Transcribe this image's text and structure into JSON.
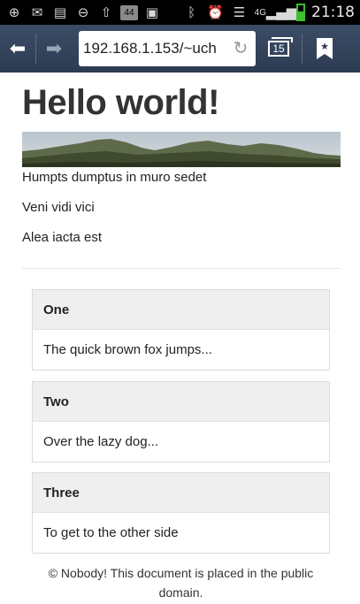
{
  "statusbar": {
    "left_icons": [
      "add-icon",
      "mail-icon",
      "clipboard-icon",
      "minus-circle-icon",
      "upload-icon"
    ],
    "badge": "44",
    "right_icons": [
      "image-icon",
      "bluetooth-icon",
      "alarm-icon",
      "wifi-icon",
      "signal-icon"
    ],
    "network": "4G",
    "time": "21:18"
  },
  "browser": {
    "url": "192.168.1.153/~uch",
    "tab_count": "15"
  },
  "page": {
    "title": "Hello world!",
    "lines": [
      "Humpts dumptus in muro sedet",
      "Veni vidi vici",
      "Alea iacta est"
    ],
    "panels": [
      {
        "heading": "One",
        "body": "The quick brown fox jumps..."
      },
      {
        "heading": "Two",
        "body": "Over the lazy dog..."
      },
      {
        "heading": "Three",
        "body": "To get to the other side"
      }
    ],
    "footer": "© Nobody! This document is placed in the public domain."
  }
}
